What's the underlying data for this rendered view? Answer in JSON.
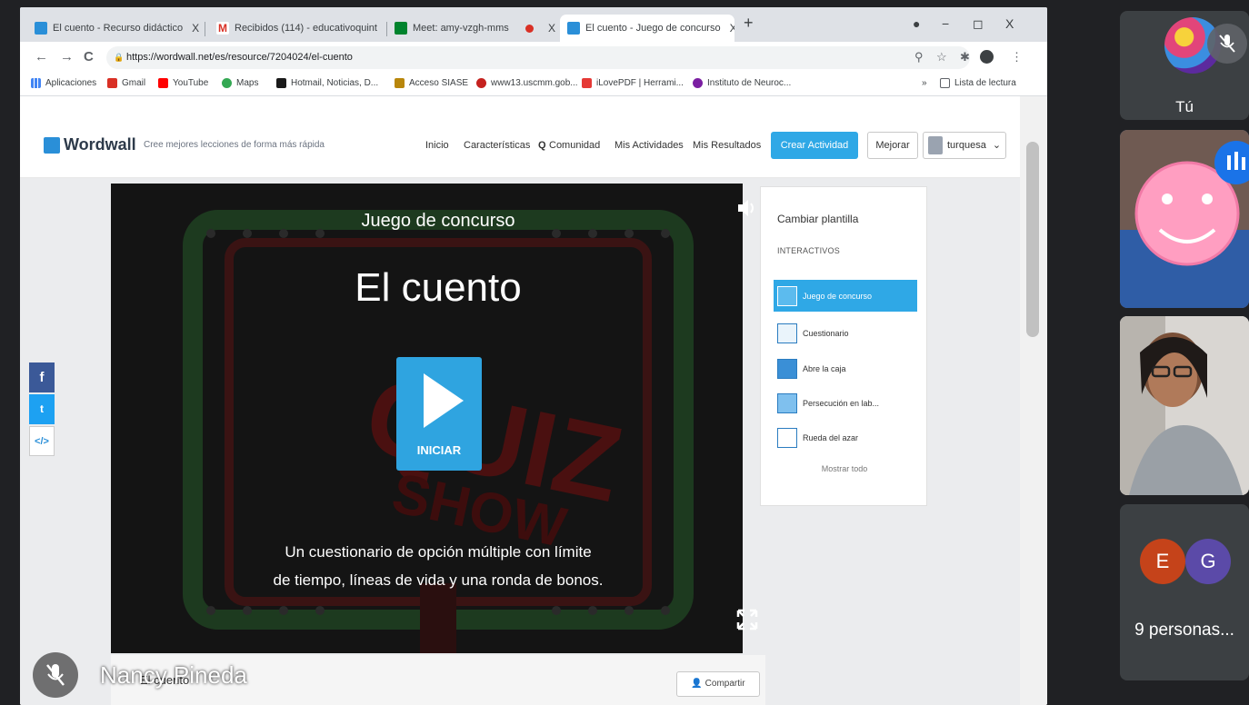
{
  "browser": {
    "tabs": [
      {
        "title": "El cuento - Recurso didáctico",
        "fav_color": "#2a8fd8"
      },
      {
        "title": "Recibidos (114) - educativoquint",
        "fav_color": "#d93025"
      },
      {
        "title": "Meet: amy-vzgh-mms",
        "fav_color": "#00832d"
      },
      {
        "title": "",
        "fav_color": "#d93025"
      },
      {
        "title": "El cuento - Juego de concurso",
        "fav_color": "#2a8fd8"
      }
    ],
    "tab_close": "X",
    "new_tab": "+",
    "window_controls": {
      "minimize": "−",
      "maximize": "◻",
      "close": "X"
    },
    "nav": {
      "back": "←",
      "forward": "→",
      "reload": "C"
    },
    "url": "https://wordwall.net/es/resource/7204024/el-cuento",
    "bookmarks": [
      {
        "label": "Aplicaciones",
        "color": "#4285f4"
      },
      {
        "label": "Gmail",
        "color": "#d93025"
      },
      {
        "label": "YouTube",
        "color": "#ff0000"
      },
      {
        "label": "Maps",
        "color": "#34a853"
      },
      {
        "label": "Hotmail, Noticias, D...",
        "color": "#1a1a1a"
      },
      {
        "label": "Acceso SIASE",
        "color": "#b8860b"
      },
      {
        "label": "www13.uscmm.gob...",
        "color": "#c5221f"
      },
      {
        "label": "iLovePDF | Herrami...",
        "color": "#e53935"
      },
      {
        "label": "Instituto de Neuroc...",
        "color": "#7b1fa2"
      }
    ],
    "bookmarks_more": "»",
    "reading_list": "Lista de lectura"
  },
  "wordwall": {
    "logo": "Wordwall",
    "tagline": "Cree mejores lecciones de forma más rápida",
    "nav": [
      "Inicio",
      "Características",
      "Comunidad",
      "Mis Actividades",
      "Mis Resultados"
    ],
    "create_button": "Crear Actividad",
    "upgrade_button": "Mejorar",
    "user": "turquesa"
  },
  "game": {
    "subtitle": "Juego de concurso",
    "title": "El cuento",
    "start_label": "INICIAR",
    "description_line1": "Un cuestionario de opción múltiple con límite",
    "description_line2": "de tiempo, líneas de vida y una ronda de bonos."
  },
  "templates": {
    "title": "Cambiar plantilla",
    "section": "INTERACTIVOS",
    "items": [
      {
        "label": "Juego de concurso",
        "active": true
      },
      {
        "label": "Cuestionario",
        "active": false
      },
      {
        "label": "Abre la caja",
        "active": false
      },
      {
        "label": "Persecución en lab...",
        "active": false
      },
      {
        "label": "Rueda del azar",
        "active": false
      }
    ],
    "show_all": "Mostrar todo"
  },
  "social": {
    "facebook": "f",
    "twitter": "t",
    "embed": "</>"
  },
  "bottom": {
    "title": "El cuento",
    "share": "Compartir"
  },
  "meet": {
    "presenter_name": "Nancy Pineda",
    "self_label": "Tú",
    "initials": [
      "E",
      "G"
    ],
    "people_label": "9 personas..."
  },
  "colors": {
    "accent": "#2fa8e6",
    "facebook": "#3b5998",
    "twitter": "#1da1f2",
    "letter_e": "#c5431a",
    "letter_g": "#5b4aa8"
  }
}
